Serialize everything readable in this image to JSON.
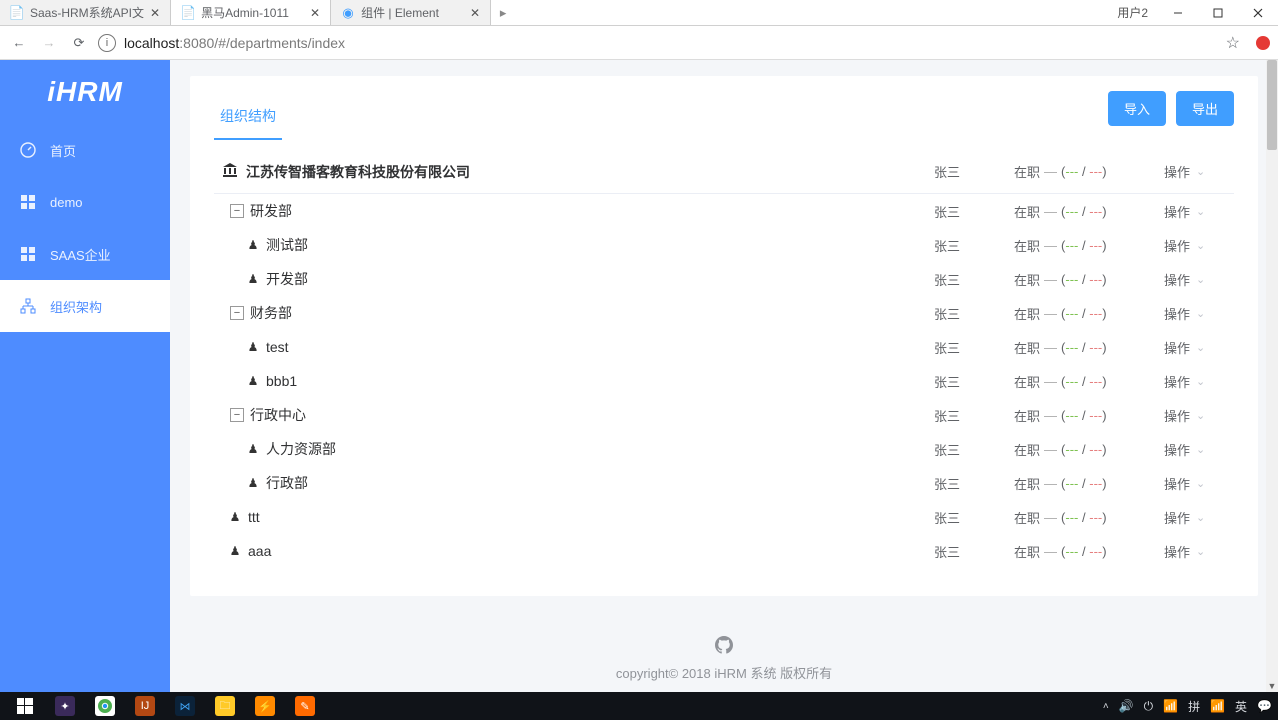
{
  "browser": {
    "tabs": [
      {
        "label": "Saas-HRM系统API文",
        "favicon": "doc"
      },
      {
        "label": "黑马Admin-1011",
        "favicon": "doc"
      },
      {
        "label": "组件 | Element",
        "favicon": "element"
      }
    ],
    "active_tab": 1,
    "os_user": "用户2",
    "url_host": "localhost",
    "url_port_path": ":8080/#/departments/index"
  },
  "sidebar": {
    "logo": "iHRM",
    "items": [
      {
        "icon": "dashboard",
        "label": "首页"
      },
      {
        "icon": "grid",
        "label": "demo"
      },
      {
        "icon": "grid",
        "label": "SAAS企业"
      },
      {
        "icon": "org",
        "label": "组织架构"
      }
    ],
    "active_index": 3
  },
  "page": {
    "tab_label": "组织结构",
    "import_btn": "导入",
    "export_btn": "导出",
    "action_label": "操作",
    "status_label": "在职",
    "manager": "张三",
    "status_bracket_open": "(",
    "status_bracket_close": ")",
    "status_dash": "—",
    "status_sep": "/",
    "status_val_a": "---",
    "status_val_b": "---",
    "tree": [
      {
        "level": 0,
        "type": "root",
        "label": "江苏传智播客教育科技股份有限公司"
      },
      {
        "level": 1,
        "type": "branch",
        "label": "研发部"
      },
      {
        "level": 2,
        "type": "leaf",
        "label": "测试部"
      },
      {
        "level": 2,
        "type": "leaf",
        "label": "开发部"
      },
      {
        "level": 1,
        "type": "branch",
        "label": "财务部"
      },
      {
        "level": 2,
        "type": "leaf",
        "label": "test"
      },
      {
        "level": 2,
        "type": "leaf",
        "label": "bbb1"
      },
      {
        "level": 1,
        "type": "branch",
        "label": "行政中心"
      },
      {
        "level": 2,
        "type": "leaf",
        "label": "人力资源部"
      },
      {
        "level": 2,
        "type": "leaf",
        "label": "行政部"
      },
      {
        "level": 1,
        "type": "leaf",
        "label": "ttt"
      },
      {
        "level": 1,
        "type": "leaf",
        "label": "aaa"
      }
    ]
  },
  "footer": {
    "copyright": "copyright© 2018 iHRM 系统 版权所有"
  },
  "taskbar": {
    "lang": "英",
    "ime1": "拼",
    "time_icon": "⏻"
  }
}
